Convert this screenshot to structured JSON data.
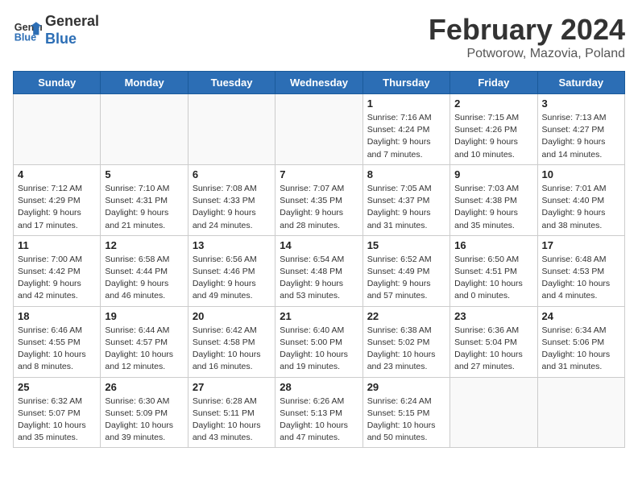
{
  "header": {
    "logo_line1": "General",
    "logo_line2": "Blue",
    "title": "February 2024",
    "subtitle": "Potworow, Mazovia, Poland"
  },
  "weekdays": [
    "Sunday",
    "Monday",
    "Tuesday",
    "Wednesday",
    "Thursday",
    "Friday",
    "Saturday"
  ],
  "weeks": [
    [
      {
        "day": "",
        "info": ""
      },
      {
        "day": "",
        "info": ""
      },
      {
        "day": "",
        "info": ""
      },
      {
        "day": "",
        "info": ""
      },
      {
        "day": "1",
        "info": "Sunrise: 7:16 AM\nSunset: 4:24 PM\nDaylight: 9 hours\nand 7 minutes."
      },
      {
        "day": "2",
        "info": "Sunrise: 7:15 AM\nSunset: 4:26 PM\nDaylight: 9 hours\nand 10 minutes."
      },
      {
        "day": "3",
        "info": "Sunrise: 7:13 AM\nSunset: 4:27 PM\nDaylight: 9 hours\nand 14 minutes."
      }
    ],
    [
      {
        "day": "4",
        "info": "Sunrise: 7:12 AM\nSunset: 4:29 PM\nDaylight: 9 hours\nand 17 minutes."
      },
      {
        "day": "5",
        "info": "Sunrise: 7:10 AM\nSunset: 4:31 PM\nDaylight: 9 hours\nand 21 minutes."
      },
      {
        "day": "6",
        "info": "Sunrise: 7:08 AM\nSunset: 4:33 PM\nDaylight: 9 hours\nand 24 minutes."
      },
      {
        "day": "7",
        "info": "Sunrise: 7:07 AM\nSunset: 4:35 PM\nDaylight: 9 hours\nand 28 minutes."
      },
      {
        "day": "8",
        "info": "Sunrise: 7:05 AM\nSunset: 4:37 PM\nDaylight: 9 hours\nand 31 minutes."
      },
      {
        "day": "9",
        "info": "Sunrise: 7:03 AM\nSunset: 4:38 PM\nDaylight: 9 hours\nand 35 minutes."
      },
      {
        "day": "10",
        "info": "Sunrise: 7:01 AM\nSunset: 4:40 PM\nDaylight: 9 hours\nand 38 minutes."
      }
    ],
    [
      {
        "day": "11",
        "info": "Sunrise: 7:00 AM\nSunset: 4:42 PM\nDaylight: 9 hours\nand 42 minutes."
      },
      {
        "day": "12",
        "info": "Sunrise: 6:58 AM\nSunset: 4:44 PM\nDaylight: 9 hours\nand 46 minutes."
      },
      {
        "day": "13",
        "info": "Sunrise: 6:56 AM\nSunset: 4:46 PM\nDaylight: 9 hours\nand 49 minutes."
      },
      {
        "day": "14",
        "info": "Sunrise: 6:54 AM\nSunset: 4:48 PM\nDaylight: 9 hours\nand 53 minutes."
      },
      {
        "day": "15",
        "info": "Sunrise: 6:52 AM\nSunset: 4:49 PM\nDaylight: 9 hours\nand 57 minutes."
      },
      {
        "day": "16",
        "info": "Sunrise: 6:50 AM\nSunset: 4:51 PM\nDaylight: 10 hours\nand 0 minutes."
      },
      {
        "day": "17",
        "info": "Sunrise: 6:48 AM\nSunset: 4:53 PM\nDaylight: 10 hours\nand 4 minutes."
      }
    ],
    [
      {
        "day": "18",
        "info": "Sunrise: 6:46 AM\nSunset: 4:55 PM\nDaylight: 10 hours\nand 8 minutes."
      },
      {
        "day": "19",
        "info": "Sunrise: 6:44 AM\nSunset: 4:57 PM\nDaylight: 10 hours\nand 12 minutes."
      },
      {
        "day": "20",
        "info": "Sunrise: 6:42 AM\nSunset: 4:58 PM\nDaylight: 10 hours\nand 16 minutes."
      },
      {
        "day": "21",
        "info": "Sunrise: 6:40 AM\nSunset: 5:00 PM\nDaylight: 10 hours\nand 19 minutes."
      },
      {
        "day": "22",
        "info": "Sunrise: 6:38 AM\nSunset: 5:02 PM\nDaylight: 10 hours\nand 23 minutes."
      },
      {
        "day": "23",
        "info": "Sunrise: 6:36 AM\nSunset: 5:04 PM\nDaylight: 10 hours\nand 27 minutes."
      },
      {
        "day": "24",
        "info": "Sunrise: 6:34 AM\nSunset: 5:06 PM\nDaylight: 10 hours\nand 31 minutes."
      }
    ],
    [
      {
        "day": "25",
        "info": "Sunrise: 6:32 AM\nSunset: 5:07 PM\nDaylight: 10 hours\nand 35 minutes."
      },
      {
        "day": "26",
        "info": "Sunrise: 6:30 AM\nSunset: 5:09 PM\nDaylight: 10 hours\nand 39 minutes."
      },
      {
        "day": "27",
        "info": "Sunrise: 6:28 AM\nSunset: 5:11 PM\nDaylight: 10 hours\nand 43 minutes."
      },
      {
        "day": "28",
        "info": "Sunrise: 6:26 AM\nSunset: 5:13 PM\nDaylight: 10 hours\nand 47 minutes."
      },
      {
        "day": "29",
        "info": "Sunrise: 6:24 AM\nSunset: 5:15 PM\nDaylight: 10 hours\nand 50 minutes."
      },
      {
        "day": "",
        "info": ""
      },
      {
        "day": "",
        "info": ""
      }
    ]
  ]
}
